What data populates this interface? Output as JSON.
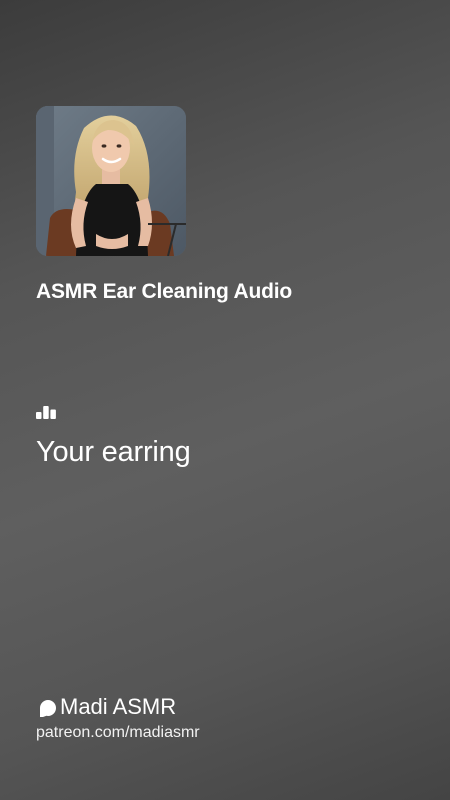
{
  "track": {
    "title": "ASMR Ear Cleaning Audio",
    "cover_icon": "portrait-photo"
  },
  "lyrics": {
    "icon": "bar-chart-icon",
    "current_line": "Your earring"
  },
  "creator": {
    "icon": "patreon-icon",
    "name": "Madi ASMR",
    "url": "patreon.com/madiasmr"
  },
  "colors": {
    "text": "#ffffff",
    "background_dark": "#3c3c3c",
    "background_light": "#5f5f5f"
  }
}
